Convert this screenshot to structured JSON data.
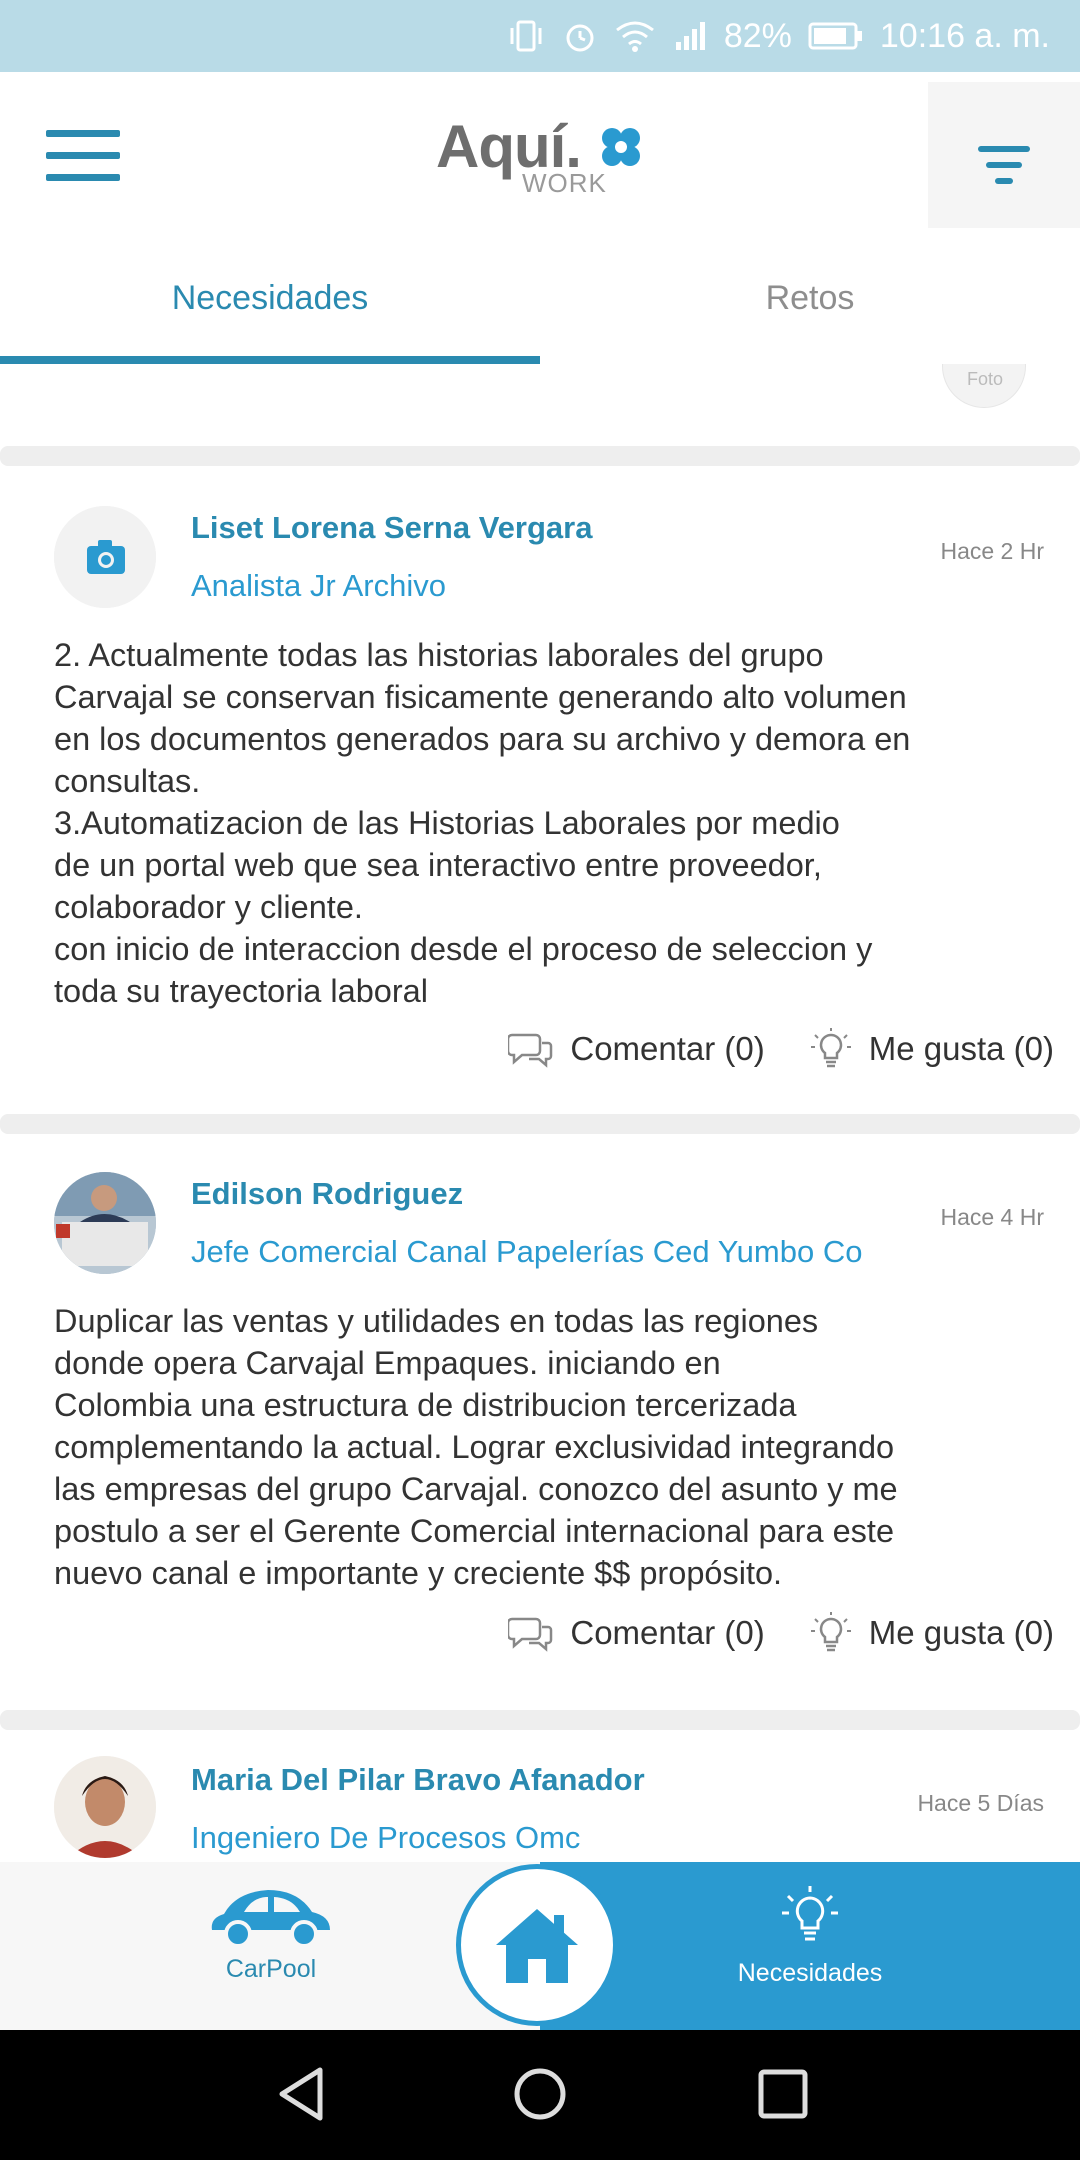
{
  "status_bar": {
    "battery": "82%",
    "time": "10:16 a. m.",
    "icons": [
      "vibrate-icon",
      "alarm-icon",
      "wifi-icon",
      "signal-icon",
      "battery-icon"
    ]
  },
  "header": {
    "logo_main": "Aquí.",
    "logo_sub": "WORK",
    "menu_icon": "menu-icon",
    "filter_icon": "filter-icon"
  },
  "tabs": [
    {
      "label": "Necesidades",
      "active": true
    },
    {
      "label": "Retos",
      "active": false
    }
  ],
  "feed": {
    "previous_avatar_label": "Foto",
    "posts": [
      {
        "author": "Liset  Lorena Serna  Vergara",
        "role": "Analista Jr Archivo",
        "time": "Hace 2 Hr",
        "avatar": "camera-icon",
        "body": [
          "2. Actualmente todas las historias laborales del grupo",
          "Carvajal se conservan fisicamente generando alto volumen",
          "en los documentos generados para su archivo y demora en",
          "consultas.",
          "3.Automatizacion de las Historias Laborales por medio",
          "de un portal web que sea interactivo entre proveedor,",
          "colaborador y cliente.",
          "con inicio de interaccion desde el proceso de seleccion y",
          "toda su trayectoria laboral"
        ],
        "comment_label": "Comentar (0)",
        "like_label": "Me gusta (0)"
      },
      {
        "author": "Edilson Rodriguez",
        "role": "Jefe Comercial Canal Papelerías Ced Yumbo Co",
        "time": "Hace 4 Hr",
        "avatar": "profile-photo",
        "body": [
          "Duplicar las ventas y utilidades en todas las regiones",
          "donde opera Carvajal Empaques. iniciando en",
          "Colombia una estructura de distribucion tercerizada",
          "complementando la actual. Lograr exclusividad integrando",
          "las empresas del grupo Carvajal. conozco del asunto y me",
          "postulo a ser el Gerente Comercial internacional para este",
          "nuevo canal e importante y creciente $$ propósito."
        ],
        "comment_label": "Comentar (0)",
        "like_label": "Me gusta (0)"
      },
      {
        "author": "Maria  Del Pilar Bravo  Afanador",
        "role": "Ingeniero De Procesos Omc",
        "time": "Hace 5 Días",
        "avatar": "profile-photo"
      }
    ]
  },
  "bottom_nav": {
    "carpool": "CarPool",
    "home_icon": "home-icon",
    "needs": "Necesidades"
  },
  "system_nav": [
    "back-icon",
    "home-circle-icon",
    "recents-icon"
  ],
  "colors": {
    "primary": "#2a8ab0",
    "accent": "#2a9ad0",
    "status_bar": "#b9dbe7"
  }
}
